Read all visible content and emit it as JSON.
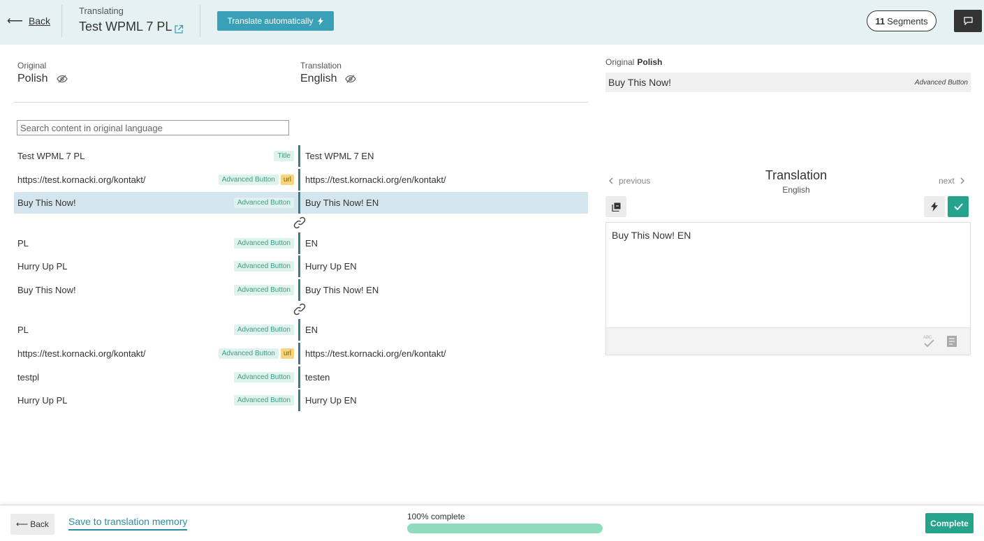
{
  "header": {
    "back_label": "Back",
    "translating_label": "Translating",
    "title": "Test WPML 7 PL",
    "translate_auto_label": "Translate automatically",
    "segments_count": "11",
    "segments_label": "Segments"
  },
  "languages": {
    "original_caption": "Original",
    "original_lang": "Polish",
    "translation_caption": "Translation",
    "translation_lang": "English"
  },
  "search": {
    "placeholder": "Search content in original language"
  },
  "segments": [
    {
      "original": "Test WPML 7 PL",
      "tags": [
        "Title"
      ],
      "translation": "Test WPML 7 EN",
      "selected": false
    },
    {
      "original": "https://test.kornacki.org/kontakt/",
      "tags": [
        "Advanced Button",
        "url"
      ],
      "translation": "https://test.kornacki.org/en/kontakt/",
      "selected": false
    },
    {
      "original": "Buy This Now!",
      "tags": [
        "Advanced Button"
      ],
      "translation": "Buy This Now! EN",
      "selected": true
    },
    {
      "original": "PL",
      "tags": [
        "Advanced Button"
      ],
      "translation": "EN",
      "selected": false
    },
    {
      "original": "Hurry Up PL",
      "tags": [
        "Advanced Button"
      ],
      "translation": "Hurry Up EN",
      "selected": false
    },
    {
      "original": "Buy This Now!",
      "tags": [
        "Advanced Button"
      ],
      "translation": "Buy This Now! EN",
      "selected": false
    },
    {
      "original": "PL",
      "tags": [
        "Advanced Button"
      ],
      "translation": "EN",
      "selected": false
    },
    {
      "original": "https://test.kornacki.org/kontakt/",
      "tags": [
        "Advanced Button",
        "url"
      ],
      "translation": "https://test.kornacki.org/en/kontakt/",
      "selected": false
    },
    {
      "original": "testpl",
      "tags": [
        "Advanced Button"
      ],
      "translation": "testen",
      "selected": false
    },
    {
      "original": "Hurry Up PL",
      "tags": [
        "Advanced Button"
      ],
      "translation": "Hurry Up EN",
      "selected": false
    }
  ],
  "right_panel": {
    "original_caption": "Original",
    "original_lang": "Polish",
    "original_text": "Buy This Now!",
    "original_badge": "Advanced Button",
    "previous_label": "previous",
    "next_label": "next",
    "translation_title": "Translation",
    "translation_lang": "English",
    "editor_text": "Buy This Now! EN"
  },
  "footer": {
    "back_label": "Back",
    "save_tm_label": "Save to translation memory",
    "progress_label": "100% complete",
    "progress_value": 100,
    "complete_label": "Complete"
  },
  "colors": {
    "accent": "#3aa0b8",
    "success": "#26a38c",
    "header_bg": "#e6f1f4",
    "selected_row": "#d5e5ee"
  },
  "icons": [
    "back-arrow-icon",
    "external-link-icon",
    "bolt-icon",
    "comment-icon",
    "eye-slash-icon",
    "link-icon",
    "chevron-left-icon",
    "chevron-right-icon",
    "copy-icon",
    "check-icon",
    "spellcheck-icon",
    "glossary-icon"
  ]
}
